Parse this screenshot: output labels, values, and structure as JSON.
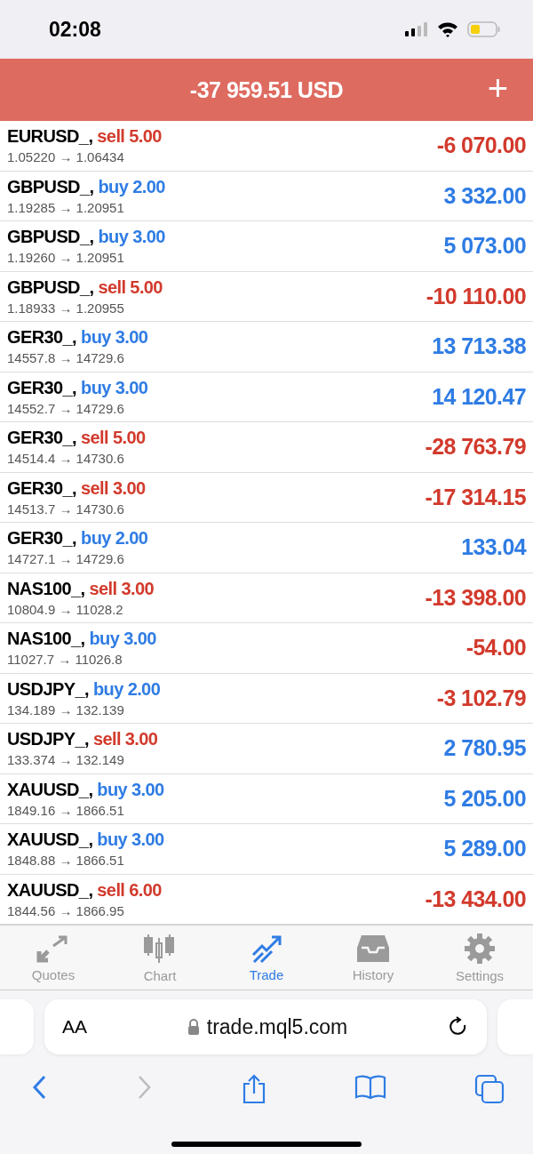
{
  "status_bar": {
    "time": "02:08"
  },
  "header": {
    "balance": "-37 959.51 USD",
    "add_label": "+"
  },
  "positions": [
    {
      "symbol": "EURUSD_,",
      "order": "sell 5.00",
      "kind": "sell",
      "prices": "1.05220 → 1.06434",
      "profit": "-6 070.00",
      "negative": true
    },
    {
      "symbol": "GBPUSD_,",
      "order": "buy 2.00",
      "kind": "buy",
      "prices": "1.19285 → 1.20951",
      "profit": "3 332.00",
      "negative": false
    },
    {
      "symbol": "GBPUSD_,",
      "order": "buy 3.00",
      "kind": "buy",
      "prices": "1.19260 → 1.20951",
      "profit": "5 073.00",
      "negative": false
    },
    {
      "symbol": "GBPUSD_,",
      "order": "sell 5.00",
      "kind": "sell",
      "prices": "1.18933 → 1.20955",
      "profit": "-10 110.00",
      "negative": true
    },
    {
      "symbol": "GER30_,",
      "order": "buy 3.00",
      "kind": "buy",
      "prices": "14557.8 → 14729.6",
      "profit": "13 713.38",
      "negative": false
    },
    {
      "symbol": "GER30_,",
      "order": "buy 3.00",
      "kind": "buy",
      "prices": "14552.7 → 14729.6",
      "profit": "14 120.47",
      "negative": false
    },
    {
      "symbol": "GER30_,",
      "order": "sell 5.00",
      "kind": "sell",
      "prices": "14514.4 → 14730.6",
      "profit": "-28 763.79",
      "negative": true
    },
    {
      "symbol": "GER30_,",
      "order": "sell 3.00",
      "kind": "sell",
      "prices": "14513.7 → 14730.6",
      "profit": "-17 314.15",
      "negative": true
    },
    {
      "symbol": "GER30_,",
      "order": "buy 2.00",
      "kind": "buy",
      "prices": "14727.1 → 14729.6",
      "profit": "133.04",
      "negative": false
    },
    {
      "symbol": "NAS100_,",
      "order": "sell 3.00",
      "kind": "sell",
      "prices": "10804.9 → 11028.2",
      "profit": "-13 398.00",
      "negative": true
    },
    {
      "symbol": "NAS100_,",
      "order": "buy 3.00",
      "kind": "buy",
      "prices": "11027.7 → 11026.8",
      "profit": "-54.00",
      "negative": true
    },
    {
      "symbol": "USDJPY_,",
      "order": "buy 2.00",
      "kind": "buy",
      "prices": "134.189 → 132.139",
      "profit": "-3 102.79",
      "negative": true
    },
    {
      "symbol": "USDJPY_,",
      "order": "sell 3.00",
      "kind": "sell",
      "prices": "133.374 → 132.149",
      "profit": "2 780.95",
      "negative": false
    },
    {
      "symbol": "XAUUSD_,",
      "order": "buy 3.00",
      "kind": "buy",
      "prices": "1849.16 → 1866.51",
      "profit": "5 205.00",
      "negative": false
    },
    {
      "symbol": "XAUUSD_,",
      "order": "buy 3.00",
      "kind": "buy",
      "prices": "1848.88 → 1866.51",
      "profit": "5 289.00",
      "negative": false
    },
    {
      "symbol": "XAUUSD_,",
      "order": "sell 6.00",
      "kind": "sell",
      "prices": "1844.56 → 1866.95",
      "profit": "-13 434.00",
      "negative": true
    }
  ],
  "tabs": [
    {
      "label": "Quotes",
      "kind": "quotes",
      "selected": false
    },
    {
      "label": "Chart",
      "kind": "chart",
      "selected": false
    },
    {
      "label": "Trade",
      "kind": "trade",
      "selected": true
    },
    {
      "label": "History",
      "kind": "history",
      "selected": false
    },
    {
      "label": "Settings",
      "kind": "settings",
      "selected": false
    }
  ],
  "browser": {
    "text_size_label": "AA",
    "url": "trade.mql5.com"
  }
}
